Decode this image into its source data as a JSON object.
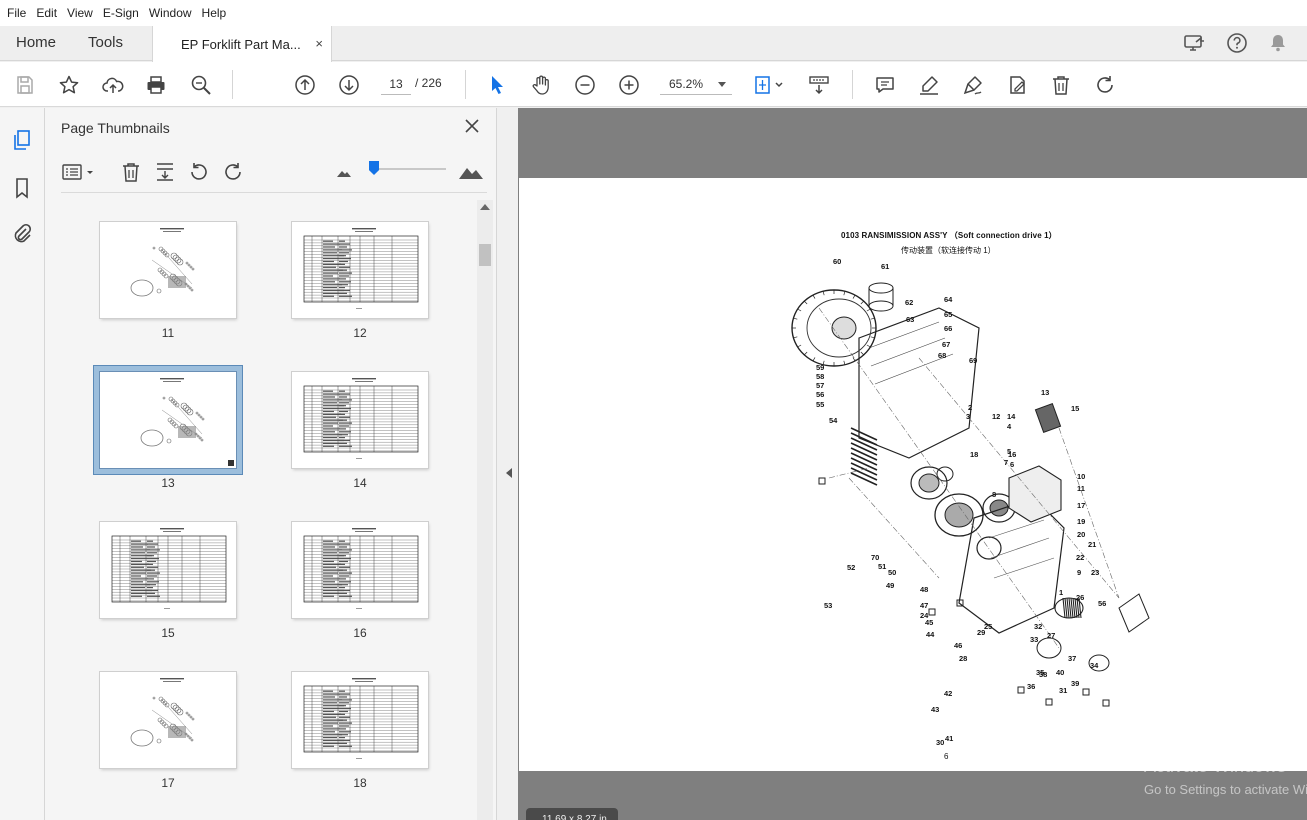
{
  "menu": [
    "File",
    "Edit",
    "View",
    "E-Sign",
    "Window",
    "Help"
  ],
  "tabs": {
    "home": "Home",
    "tools": "Tools",
    "document": "EP Forklift Part Ma...",
    "close": "×"
  },
  "toolbar": {
    "current_page": "13",
    "total_pages": "/ 226",
    "zoom": "65.2%"
  },
  "panel": {
    "title": "Page Thumbnails",
    "thumbnails": [
      {
        "label": "11",
        "kind": "drawing"
      },
      {
        "label": "12",
        "kind": "table"
      },
      {
        "label": "13",
        "kind": "drawing",
        "selected": true
      },
      {
        "label": "14",
        "kind": "table"
      },
      {
        "label": "15",
        "kind": "table"
      },
      {
        "label": "16",
        "kind": "table"
      },
      {
        "label": "17",
        "kind": "drawing"
      },
      {
        "label": "18",
        "kind": "table"
      }
    ]
  },
  "document_page": {
    "title": "0103 RANSIMISSION ASS'Y （Soft connection drive 1）",
    "subtitle": "传动装置（软连接传动 1）",
    "page_number": "6",
    "callouts": [
      "60",
      "61",
      "62",
      "63",
      "64",
      "65",
      "66",
      "67",
      "68",
      "69",
      "59",
      "58",
      "57",
      "56",
      "55",
      "54",
      "13",
      "15",
      "2",
      "3",
      "12",
      "14",
      "4",
      "5",
      "16",
      "18",
      "6",
      "7",
      "8",
      "10",
      "11",
      "17",
      "19",
      "20",
      "21",
      "22",
      "9",
      "23",
      "70",
      "51",
      "52",
      "53",
      "50",
      "49",
      "48",
      "47",
      "24",
      "25",
      "46",
      "26",
      "27",
      "28",
      "45",
      "44",
      "43",
      "42",
      "41",
      "30",
      "31",
      "29",
      "56",
      "32",
      "33",
      "34",
      "37",
      "35",
      "40",
      "39",
      "38",
      "36",
      "1"
    ]
  },
  "status": {
    "page_size": "11.69 x 8.27 in"
  },
  "watermark": {
    "line1": "Activate Windows",
    "line2": "Go to Settings to activate Windows."
  }
}
